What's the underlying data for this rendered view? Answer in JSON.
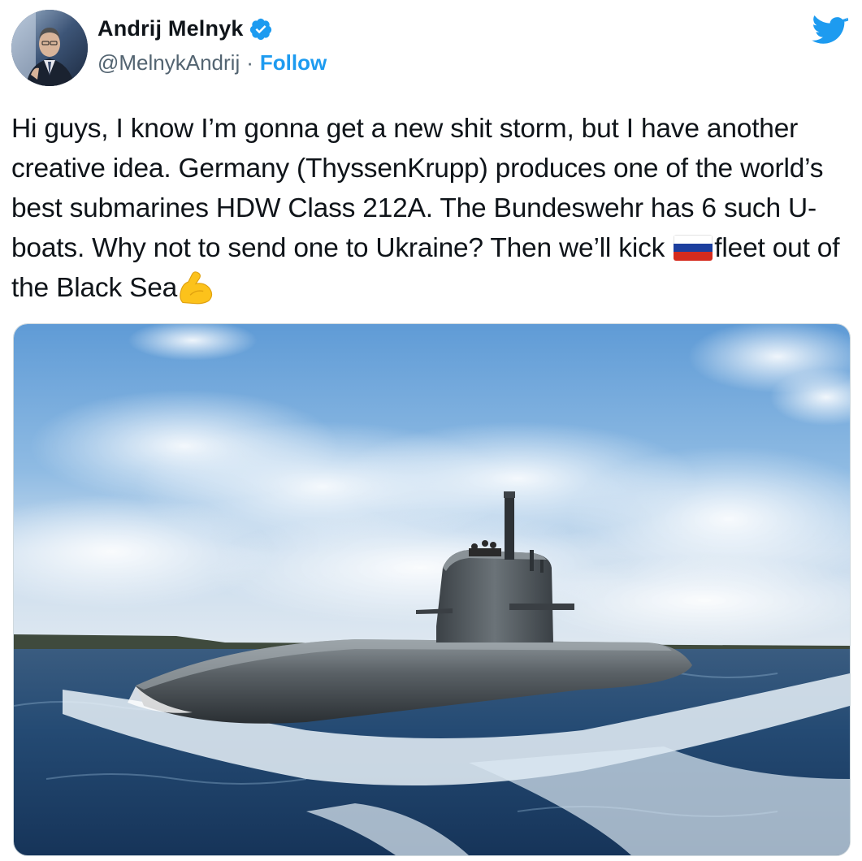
{
  "author": {
    "name": "Andrij Melnyk",
    "handle": "@MelnykAndrij",
    "separator": "·",
    "follow_label": "Follow",
    "verified": true,
    "avatar_icon": "avatar-photo"
  },
  "brand": {
    "icon": "twitter-bird-icon",
    "color": "#1d9bf0"
  },
  "tweet": {
    "text_part1": "Hi guys, I know I’m gonna get a new shit storm, but I have another creative idea. Germany (ThyssenKrupp) produces one of the world’s best submarines HDW Class 212A. The Bundeswehr has 6 such U-boats. Why not to send one to Ukraine? Then we’ll kick ",
    "flag_emoji": "russia-flag",
    "text_part2": "fleet out of the Black Sea",
    "trailing_emoji": "flexed-biceps"
  },
  "media": {
    "type": "photo",
    "subject": "submarine"
  },
  "colors": {
    "text": "#0f1419",
    "secondary": "#536471",
    "accent": "#1d9bf0"
  }
}
